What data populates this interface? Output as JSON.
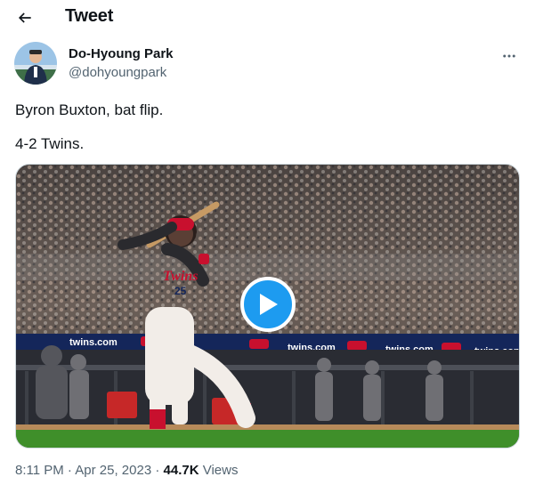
{
  "header": {
    "title": "Tweet"
  },
  "author": {
    "name": "Do-Hyoung Park",
    "handle": "@dohyoungpark"
  },
  "tweet": {
    "lines": [
      "Byron Buxton, bat flip.",
      "4-2 Twins."
    ]
  },
  "media": {
    "type": "video",
    "banners": [
      "twins.com",
      "twins.com",
      "twins.com",
      "twins.com"
    ],
    "jersey_wordmark": "Twins",
    "jersey_number": "25"
  },
  "meta": {
    "time": "8:11 PM",
    "separator": "·",
    "date": "Apr 25, 2023",
    "views_count": "44.7K",
    "views_label": "Views"
  },
  "colors": {
    "accent": "#1d9bf0",
    "text": "#0f1419",
    "secondary": "#536471"
  }
}
